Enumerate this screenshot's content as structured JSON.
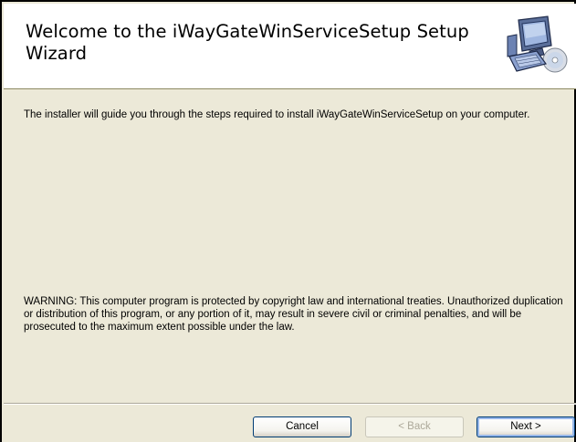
{
  "banner": {
    "title": "Welcome to the iWayGateWinServiceSetup Setup Wizard",
    "icon": "computer-setup-icon"
  },
  "content": {
    "intro": "The installer will guide you through the steps required to install iWayGateWinServiceSetup on your computer.",
    "warning": "WARNING: This computer program is protected by copyright law and international treaties. Unauthorized duplication or distribution of this program, or any portion of it, may result in severe civil or criminal penalties, and will be prosecuted to the maximum extent possible under the law."
  },
  "buttons": {
    "cancel": "Cancel",
    "back": "< Back",
    "next": "Next >"
  },
  "colors": {
    "background": "#ece9d8",
    "banner": "#ffffff",
    "button_border": "#003c74",
    "disabled_text": "#aca899"
  }
}
